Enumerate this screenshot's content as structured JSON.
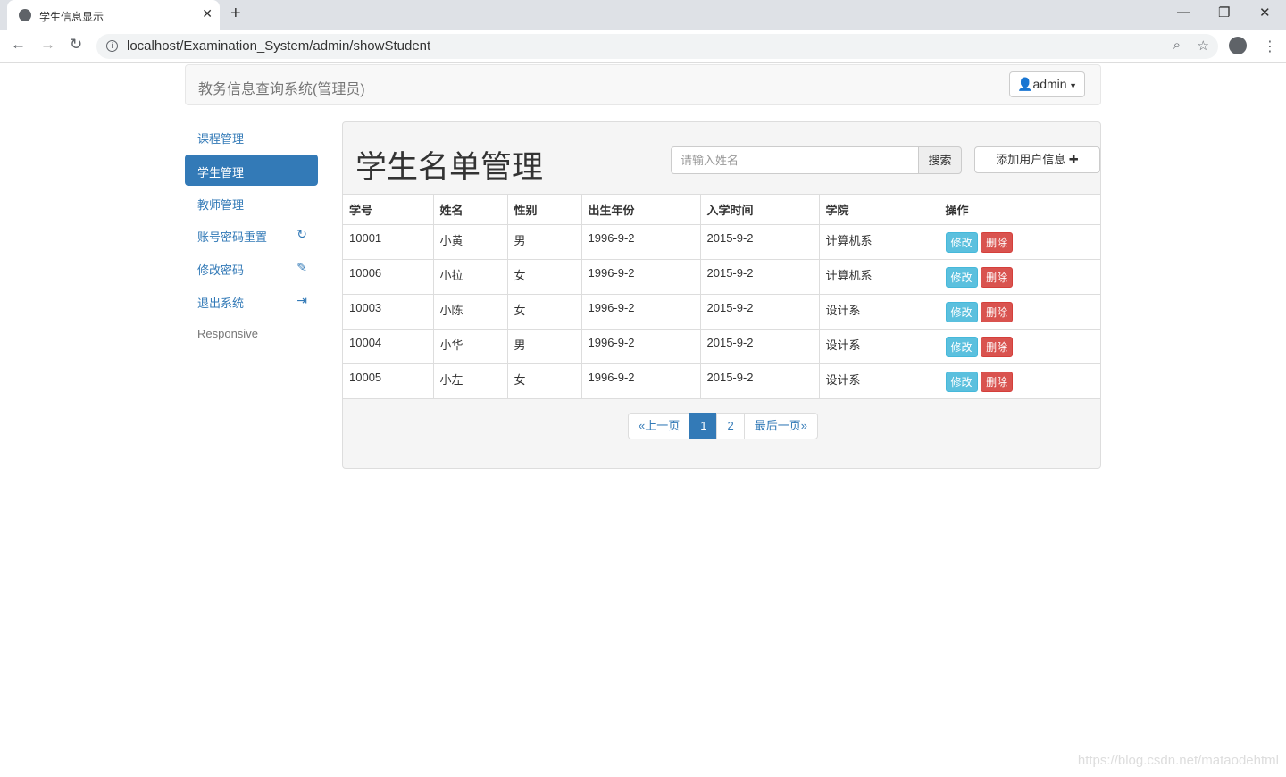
{
  "browser": {
    "tab_title": "学生信息显示",
    "url": "localhost/Examination_System/admin/showStudent",
    "new_tab": "+",
    "close": "✕"
  },
  "navbar": {
    "brand": "教务信息查询系统(管理员)",
    "user": "admin"
  },
  "sidebar": {
    "items": [
      {
        "label": "课程管理"
      },
      {
        "label": "学生管理"
      },
      {
        "label": "教师管理"
      },
      {
        "label": "账号密码重置"
      },
      {
        "label": "修改密码"
      },
      {
        "label": "退出系统"
      },
      {
        "label": "Responsive"
      }
    ]
  },
  "main": {
    "title": "学生名单管理",
    "search_placeholder": "请输入姓名",
    "search_label": "搜索",
    "add_label": "添加用户信息",
    "columns": [
      "学号",
      "姓名",
      "性别",
      "出生年份",
      "入学时间",
      "学院",
      "操作"
    ],
    "rows": [
      [
        "10001",
        "小黄",
        "男",
        "1996-9-2",
        "2015-9-2",
        "计算机系"
      ],
      [
        "10006",
        "小拉",
        "女",
        "1996-9-2",
        "2015-9-2",
        "计算机系"
      ],
      [
        "10003",
        "小陈",
        "女",
        "1996-9-2",
        "2015-9-2",
        "设计系"
      ],
      [
        "10004",
        "小华",
        "男",
        "1996-9-2",
        "2015-9-2",
        "设计系"
      ],
      [
        "10005",
        "小左",
        "女",
        "1996-9-2",
        "2015-9-2",
        "设计系"
      ]
    ],
    "edit_label": "修改",
    "delete_label": "删除",
    "pagination": {
      "prev": "«上一页",
      "pages": [
        "1",
        "2"
      ],
      "current": "1",
      "last": "最后一页»"
    }
  },
  "watermark": "https://blog.csdn.net/mataodehtml"
}
